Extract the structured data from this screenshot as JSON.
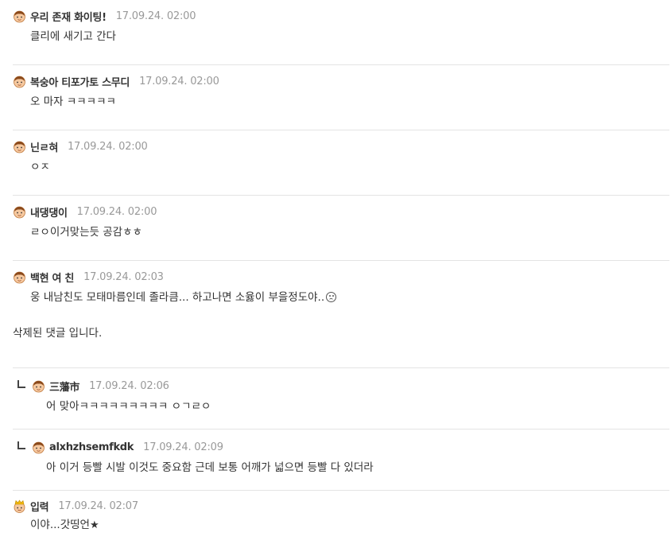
{
  "comments": [
    {
      "nick": "우리 존재 화이팅!",
      "date": "17.09.24. 02:00",
      "text": "클리에 새기고 간다",
      "avatar": "boy"
    },
    {
      "nick": "복숭아 티포가토 스무디",
      "date": "17.09.24. 02:00",
      "text": "오 마자 ㅋㅋㅋㅋㅋ",
      "avatar": "boy"
    },
    {
      "nick": "닌ㄹ혀",
      "date": "17.09.24. 02:00",
      "text": "ㅇㅈ",
      "avatar": "boy"
    },
    {
      "nick": "내댕댕이",
      "date": "17.09.24. 02:00",
      "text": "ㄹㅇ이거맞는듯 공감ㅎㅎ",
      "avatar": "boy"
    },
    {
      "nick": "백현 여 친",
      "date": "17.09.24. 02:03",
      "text": "웅 내남친도 모태마름인데 졸라큼... 하고나면 소윯이 부을정도야..",
      "avatar": "boy"
    }
  ],
  "deleted_text": "삭제된 댓글 입니다.",
  "replies": [
    {
      "nick": "三藩市",
      "date": "17.09.24. 02:06",
      "text": "어 맞아ㅋㅋㅋㅋㅋㅋㅋㅋㅋ ㅇㄱㄹㅇ",
      "avatar": "boy"
    },
    {
      "nick": "alxhzhsemfkdk",
      "date": "17.09.24. 02:09",
      "text": "아 이거 등빨 시발 이것도 중요함 근데 보통 어깨가 넓으면 등빨 다 있더라",
      "avatar": "boy"
    }
  ],
  "last": {
    "nick": "입력",
    "date": "17.09.24. 02:07",
    "text": "이야...갓띵언",
    "avatar": "crown"
  },
  "colors": {
    "divider": "#e4e4e4",
    "date": "#999999",
    "text": "#333333"
  }
}
